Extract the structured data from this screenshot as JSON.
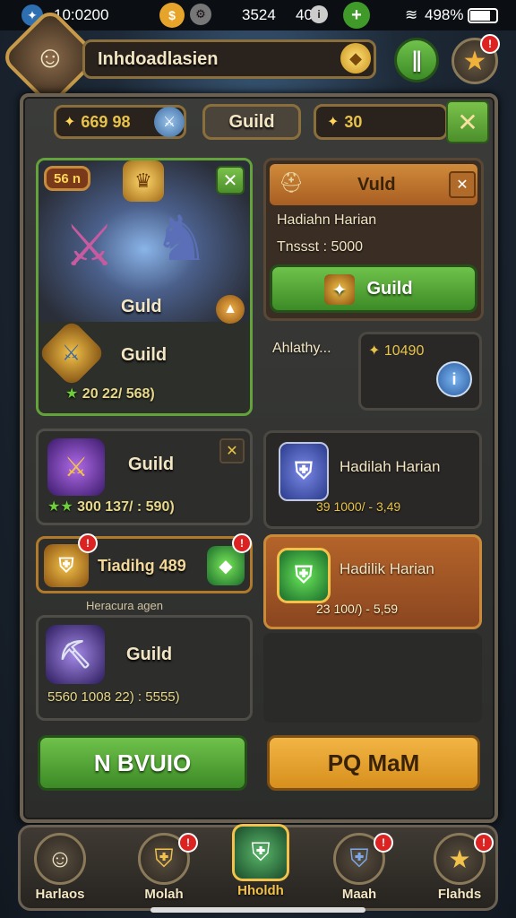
{
  "status": {
    "time": "10:0200",
    "value1": "3524",
    "value2": "40",
    "battery": "498%"
  },
  "header": {
    "player_name": "Inhdoadlasien"
  },
  "currency": {
    "gold": "669 98",
    "guild_tab": "Guild",
    "gems": "30"
  },
  "hero_card": {
    "level": "56 n",
    "title": "Guld",
    "subtitle": "Guild",
    "stats": "20 22/ 568)"
  },
  "vuld_panel": {
    "title": "Vuld",
    "line1": "Hadiahn Harian",
    "line2": "Tnssst : 5000",
    "button": "Guild"
  },
  "ally": {
    "label": "Ahlathy...",
    "value": "10490"
  },
  "items": [
    {
      "name": "Guild",
      "stats": "300 137/ : 590)"
    },
    {
      "name": "Hadilah Harian",
      "stats": "39 1000/ - 3,49"
    },
    {
      "name": "Tiadihg 489",
      "sub": "Heracura agen"
    },
    {
      "name": "Hadilik Harian",
      "stats": "23 100/) - 5,59"
    },
    {
      "name": "Guild",
      "stats": "5560 1008 22) : 5555)"
    }
  ],
  "buttons": {
    "left": "N BVUIO",
    "right": "PQ MaM"
  },
  "nav": [
    {
      "label": "Harlaos"
    },
    {
      "label": "Molah"
    },
    {
      "label": "Hholdh"
    },
    {
      "label": "Maah"
    },
    {
      "label": "Flahds"
    }
  ],
  "colors": {
    "green": "#5fb33a",
    "orange": "#e9a733",
    "frame": "#6b6152"
  }
}
